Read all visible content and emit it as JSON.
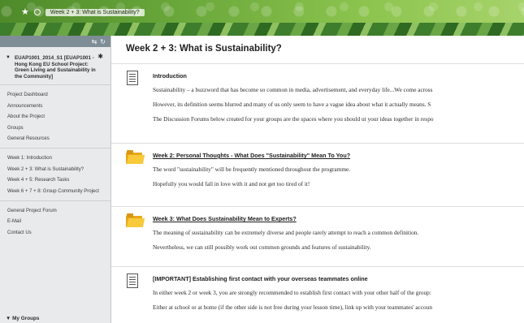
{
  "breadcrumb": {
    "home_icon": "home-icon",
    "current": "Week 2 + 3: What is Sustainability?"
  },
  "sidebar": {
    "course_title": "EUAP1001_2014_S1 [EUAP1001 - Hong Kong EU School Project: Green Living and Sustainability in the Community]",
    "groups": [
      [
        "Project Dashboard",
        "Announcements",
        "About the Project",
        "Groups",
        "General Resources"
      ],
      [
        "Week 1: Introduction",
        "Week 2 + 3: What is Sustainability?",
        "Week 4 + 5: Research Tasks",
        "Week 6 + 7 + 8: Group Community Project"
      ],
      [
        "General Project Forum",
        "E-Mail",
        "Contact Us"
      ]
    ],
    "my_groups": "My Groups"
  },
  "main": {
    "title": "Week 2 + 3: What is Sustainability?",
    "items": [
      {
        "type": "document",
        "heading": "Introduction",
        "lines": [
          "Sustainability – a buzzword that has become so common in media, advertisement, and everyday life...We come across",
          "However, its definition seems blurred and many of us only seem to have a vague idea about what it actually means. S",
          "The Discussion Forums below created for your groups are the spaces where you should ut your ideas together in respo"
        ]
      },
      {
        "type": "folder",
        "heading": "Week 2: Personal Thoughts - What Does \"Sustainability\" Mean To You?",
        "lines": [
          "The word \"sustainability\" will be frequently mentioned throughout the programme.",
          "Hopefully you would fall in love with it and not get too tired of it!"
        ]
      },
      {
        "type": "folder",
        "heading": "Week 3: What Does Sustainability Mean to Experts?",
        "lines": [
          "The meaning of sustainability can be extremely diverse and people rarely attempt to reach a common definition.",
          "Nevertheless, we can still possibly work out common grounds and features of sustainability."
        ]
      },
      {
        "type": "document",
        "heading": "[IMPORTANT] Establishing first contact with your overseas teammates online",
        "lines": [
          "In either week 2 or week 3, you are strongly recommended to establish first contact with your other half of the group:",
          "Either at school or at home (if the other side is not free during your lesson time), link up with your teammates' accoun"
        ]
      }
    ]
  },
  "colors": {
    "top_bar": "#6aa83b",
    "folder": "#f8c93b"
  }
}
